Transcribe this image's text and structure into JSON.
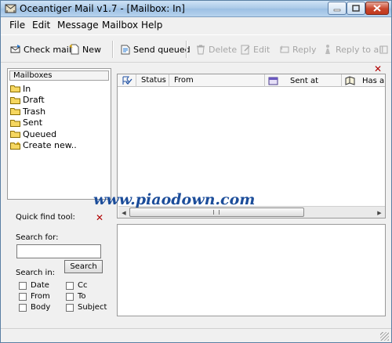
{
  "window": {
    "title": "Oceantiger Mail v1.7 - [Mailbox: In]"
  },
  "menu": [
    "File",
    "Edit",
    "Message",
    "Mailbox",
    "Help"
  ],
  "toolbar": {
    "check_mail": "Check mail",
    "new": "New",
    "send_queued": "Send queued",
    "delete": "Delete",
    "edit": "Edit",
    "reply": "Reply",
    "reply_all": "Reply to all"
  },
  "mailboxes": {
    "header": "Mailboxes",
    "folders": [
      "In",
      "Draft",
      "Trash",
      "Sent",
      "Queued",
      "Create new.."
    ]
  },
  "quick_find": {
    "title": "Quick find tool:",
    "search_for": "Search for:",
    "search_button": "Search",
    "search_in": "Search in:",
    "options": [
      "Date",
      "Cc",
      "From",
      "To",
      "Body",
      "Subject"
    ]
  },
  "message_list": {
    "columns": [
      "Status",
      "From",
      "Sent at",
      "Has a"
    ]
  },
  "watermark": "www.piaodown.com"
}
